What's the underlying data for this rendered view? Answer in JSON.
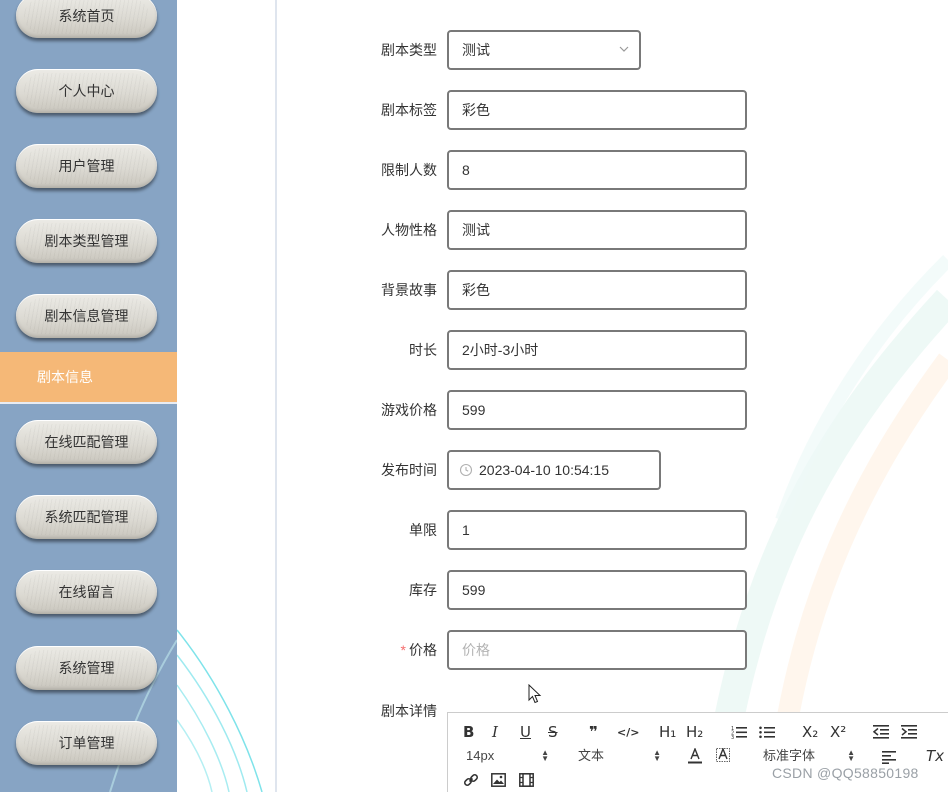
{
  "sidebar": {
    "items": [
      {
        "label": "系统首页"
      },
      {
        "label": "个人中心"
      },
      {
        "label": "用户管理"
      },
      {
        "label": "剧本类型管理"
      },
      {
        "label": "剧本信息管理"
      },
      {
        "label": "在线匹配管理"
      },
      {
        "label": "系统匹配管理"
      },
      {
        "label": "在线留言"
      },
      {
        "label": "系统管理"
      },
      {
        "label": "订单管理"
      }
    ],
    "active_sub_item": "剧本信息",
    "colors": {
      "background": "#87a4c4",
      "active": "#f5b877"
    }
  },
  "form": {
    "script_type": {
      "label": "剧本类型",
      "value": "测试"
    },
    "script_tag": {
      "label": "剧本标签",
      "value": "彩色"
    },
    "player_limit": {
      "label": "限制人数",
      "value": "8"
    },
    "character_personality": {
      "label": "人物性格",
      "value": "测试"
    },
    "background_story": {
      "label": "背景故事",
      "value": "彩色"
    },
    "duration": {
      "label": "时长",
      "value": "2小时-3小时"
    },
    "game_price": {
      "label": "游戏价格",
      "value": "599"
    },
    "publish_time": {
      "label": "发布时间",
      "value": "2023-04-10 10:54:15"
    },
    "single_limit": {
      "label": "单限",
      "value": "1"
    },
    "stock": {
      "label": "库存",
      "value": "599"
    },
    "price": {
      "label": "价格",
      "required_mark": "*",
      "value": "",
      "placeholder": "价格"
    },
    "script_detail": {
      "label": "剧本详情"
    }
  },
  "editor_toolbar": {
    "bold": "B",
    "italic": "I",
    "underline": "U",
    "strike": "S",
    "quote": "❞",
    "code": "</>",
    "h1": "H₁",
    "h2": "H₂",
    "ordered_list": "ordered-list-icon",
    "bullet_list": "bullet-list-icon",
    "subscript": "X₂",
    "superscript": "X²",
    "font_size": "14px",
    "block_type": "文本",
    "font_family": "标准字体",
    "clear_format": "Tx"
  },
  "watermark": "CSDN @QQ58850198"
}
